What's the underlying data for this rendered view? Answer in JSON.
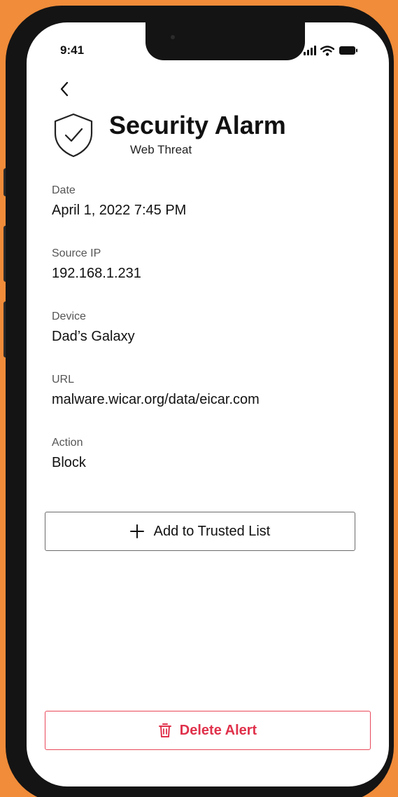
{
  "status_bar": {
    "time": "9:41",
    "icons": [
      "signal-icon",
      "wifi-icon",
      "battery-icon"
    ]
  },
  "header": {
    "back_icon": "chevron-left-icon",
    "icon": "shield-check-icon",
    "title": "Security Alarm",
    "subtitle": "Web Threat"
  },
  "details": [
    {
      "label": "Date",
      "value": "April 1, 2022 7:45 PM"
    },
    {
      "label": "Source IP",
      "value": "192.168.1.231"
    },
    {
      "label": "Device",
      "value": "Dad’s Galaxy"
    },
    {
      "label": "URL",
      "value": "malware.wicar.org/data/eicar.com"
    },
    {
      "label": "Action",
      "value": "Block"
    }
  ],
  "actions": {
    "trusted_label": "Add to Trusted List",
    "trusted_icon": "plus-icon",
    "delete_label": "Delete Alert",
    "delete_icon": "trash-icon"
  },
  "colors": {
    "background": "#f08c3a",
    "danger": "#e0314b",
    "text": "#111111"
  }
}
